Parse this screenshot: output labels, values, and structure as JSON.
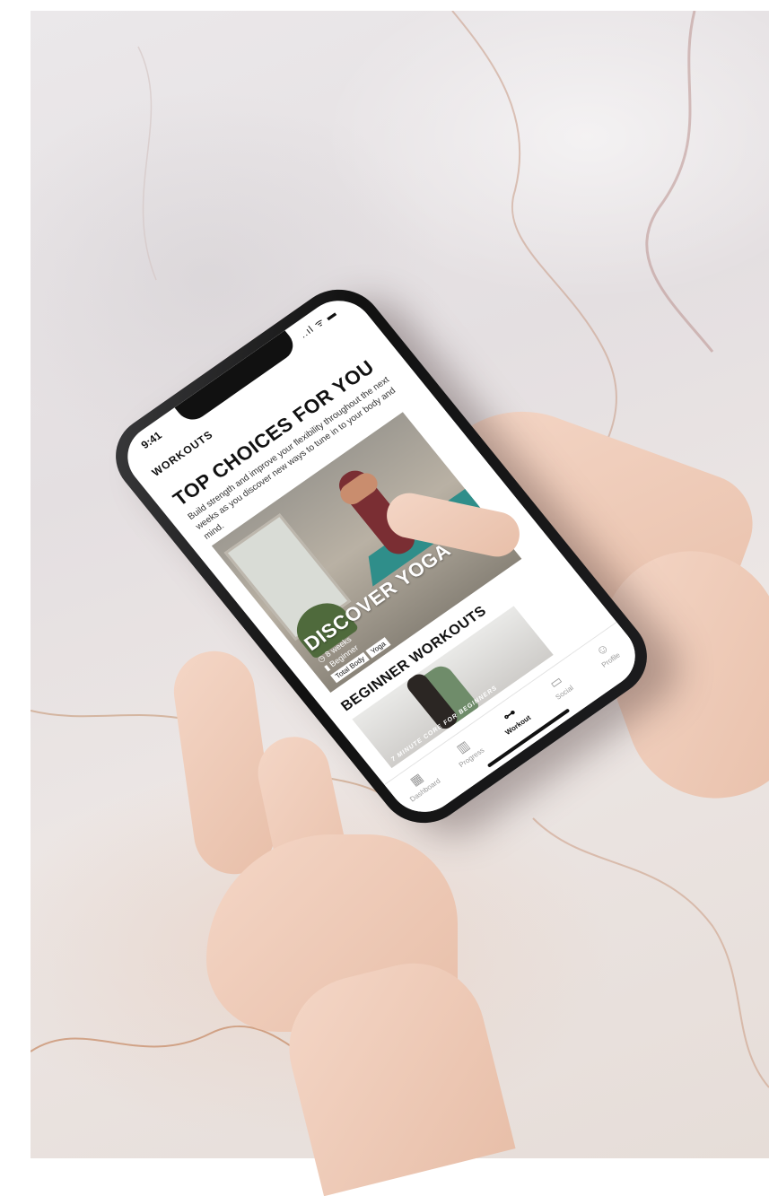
{
  "status_bar": {
    "time": "9:41",
    "icons": "..ıl ᯤ ▬"
  },
  "header": {
    "title": "WORKOUTS"
  },
  "section_top": {
    "title": "TOP CHOICES FOR YOU",
    "description": "Build strength and improve your flexibility throughout the next weeks as you discover new ways to tune in to your body and mind."
  },
  "card_yoga": {
    "title": "DISCOVER YOGA",
    "duration": "8 weeks",
    "level": "Beginner",
    "tags": [
      "Total Body",
      "Yoga"
    ]
  },
  "section_beginner": {
    "title": "BEGINNER WORKOUTS",
    "card_caption": "7 MINUTE CORE FOR BEGINNERS"
  },
  "tabbar": {
    "items": [
      {
        "label": "Dashboard",
        "icon": "calendar-icon"
      },
      {
        "label": "Progress",
        "icon": "bar-chart-icon"
      },
      {
        "label": "Workout",
        "icon": "dumbbell-icon"
      },
      {
        "label": "Social",
        "icon": "chat-icon"
      },
      {
        "label": "Profile",
        "icon": "person-icon"
      }
    ]
  },
  "colors": {
    "accent": "#111111",
    "inactive": "#999999",
    "mat": "#2f8e8a",
    "outfit": "#7a2e33"
  }
}
